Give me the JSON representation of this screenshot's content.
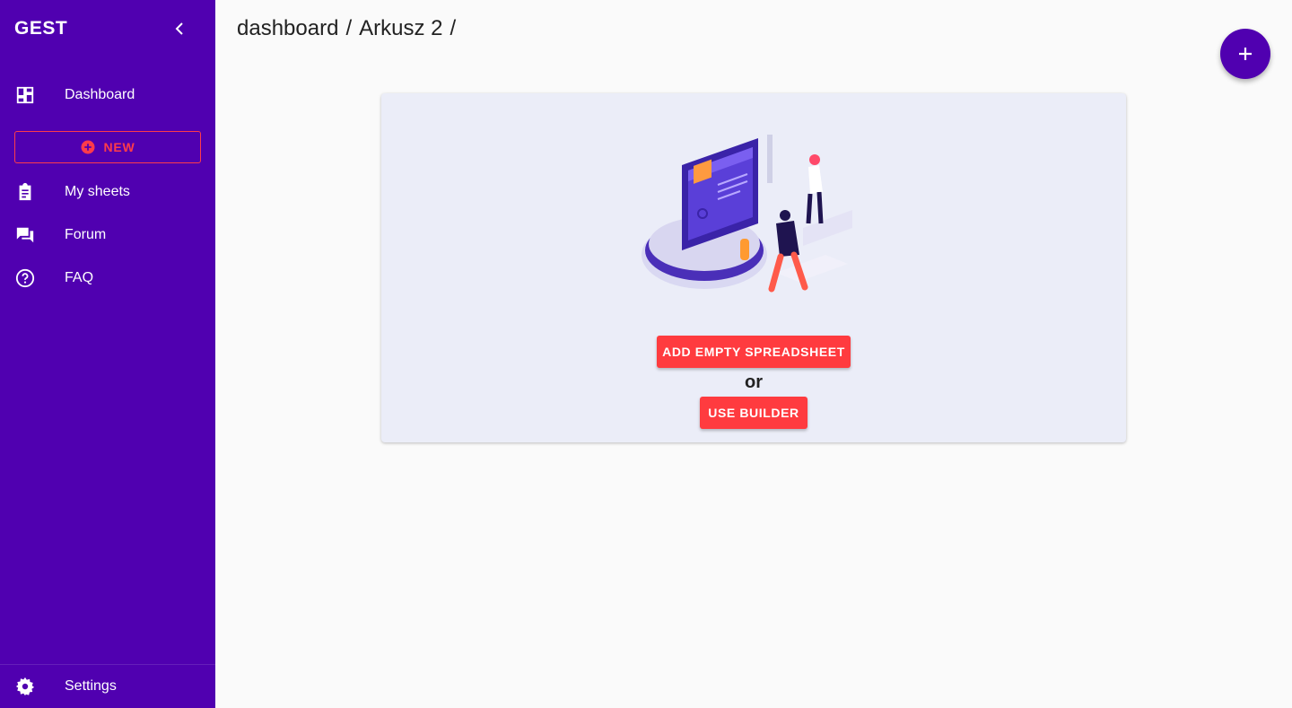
{
  "sidebar": {
    "brand": "GEST",
    "items": [
      {
        "label": "Dashboard",
        "icon": "dashboard-icon"
      },
      {
        "label": "My sheets",
        "icon": "clipboard-icon"
      },
      {
        "label": "Forum",
        "icon": "forum-icon"
      },
      {
        "label": "FAQ",
        "icon": "help-circle-icon"
      }
    ],
    "new_label": "NEW",
    "settings_label": "Settings"
  },
  "breadcrumb": [
    "dashboard",
    "/",
    "Arkusz 2",
    "/"
  ],
  "main": {
    "add_empty_label": "ADD EMPTY SPREADSHEET",
    "or_label": "or",
    "builder_label": "USE BUILDER"
  },
  "colors": {
    "sidebar": "#5000b0",
    "accent": "#ff3b3f",
    "card": "#ebedf8"
  }
}
